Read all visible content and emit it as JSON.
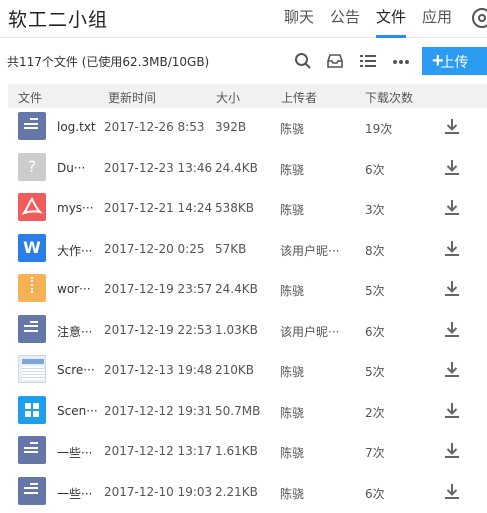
{
  "header": {
    "group_name": "软工二小组",
    "tabs": [
      "聊天",
      "公告",
      "文件",
      "应用"
    ],
    "active_tab": 2
  },
  "toolbar": {
    "summary": "共117个文件 (已使用62.3MB/10GB)",
    "upload_label": "上传",
    "icons": [
      "search-icon",
      "inbox-icon",
      "list-view-icon",
      "more-icon"
    ]
  },
  "columns": {
    "file": "文件",
    "updated": "更新时间",
    "size": "大小",
    "uploader": "上传者",
    "downloads": "下载次数"
  },
  "colors": {
    "accent": "#2b9cf2",
    "text": "#e8f3fb",
    "unknown": "#cccccc",
    "pdf": "#f15b5b",
    "word": "#2b7de9",
    "zip": "#f7b155",
    "windows": "#1e9ef0"
  },
  "files": [
    {
      "name": "log.txt",
      "time": "2017-12-26 8:53",
      "size": "392B",
      "uploader": "陈骁",
      "downloads": "19次",
      "icon": "text-file-icon",
      "color": "#6477a8"
    },
    {
      "name": "Du···",
      "time": "2017-12-23 13:46",
      "size": "24.4KB",
      "uploader": "陈骁",
      "downloads": "6次",
      "icon": "unknown-file-icon",
      "color": "#cccccc"
    },
    {
      "name": "mys···",
      "time": "2017-12-21 14:24",
      "size": "538KB",
      "uploader": "陈骁",
      "downloads": "3次",
      "icon": "pdf-file-icon",
      "color": "#f15b5b"
    },
    {
      "name": "大作···",
      "time": "2017-12-20 0:25",
      "size": "57KB",
      "uploader": "该用户昵···",
      "downloads": "8次",
      "icon": "word-file-icon",
      "color": "#2b7de9"
    },
    {
      "name": "wor···",
      "time": "2017-12-19 23:57",
      "size": "24.4KB",
      "uploader": "陈骁",
      "downloads": "5次",
      "icon": "zip-file-icon",
      "color": "#f7b155"
    },
    {
      "name": "注意···",
      "time": "2017-12-19 22:53",
      "size": "1.03KB",
      "uploader": "该用户昵···",
      "downloads": "6次",
      "icon": "text-file-icon",
      "color": "#6477a8"
    },
    {
      "name": "Scre···",
      "time": "2017-12-13 19:48",
      "size": "210KB",
      "uploader": "陈骁",
      "downloads": "5次",
      "icon": "screenshot-file-icon",
      "color": "#e9eef6"
    },
    {
      "name": "Scen···",
      "time": "2017-12-12 19:31",
      "size": "50.7MB",
      "uploader": "陈骁",
      "downloads": "2次",
      "icon": "windows-file-icon",
      "color": "#1e9ef0"
    },
    {
      "name": "一些···",
      "time": "2017-12-12 13:17",
      "size": "1.61KB",
      "uploader": "陈骁",
      "downloads": "7次",
      "icon": "text-file-icon",
      "color": "#6477a8"
    },
    {
      "name": "一些···",
      "time": "2017-12-10 19:03",
      "size": "2.21KB",
      "uploader": "陈骁",
      "downloads": "6次",
      "icon": "text-file-icon",
      "color": "#6477a8"
    }
  ]
}
